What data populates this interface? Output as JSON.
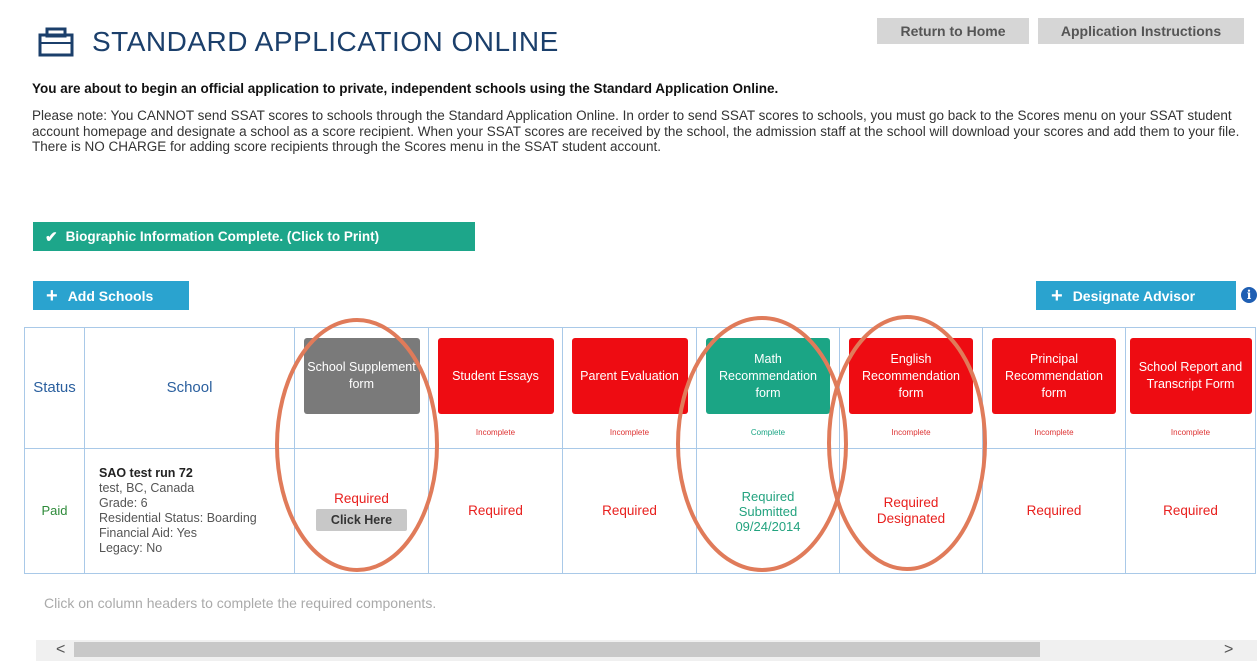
{
  "header": {
    "title": "STANDARD APPLICATION ONLINE",
    "return_home": "Return to Home",
    "instructions": "Application Instructions"
  },
  "intro": "You are about to begin an official application to private, independent schools using the Standard Application Online.",
  "note": "Please note: You CANNOT send SSAT scores to schools through the Standard Application Online. In order to send SSAT scores to schools, you must go back to the Scores menu on your SSAT student account homepage and designate a school as a score recipient. When your SSAT scores are received by the school, the admission staff at the school will download your scores and add them to your file. There is NO CHARGE for adding score recipients through the Scores menu in the SSAT student account.",
  "bio_button": "Biographic Information Complete. (Click to Print)",
  "add_schools": "Add Schools",
  "designate_advisor": "Designate Advisor",
  "table": {
    "status_header": "Status",
    "school_header": "School",
    "columns": [
      {
        "label": "School Supplement form",
        "status": "",
        "color": "grey"
      },
      {
        "label": "Student Essays",
        "status": "Incomplete",
        "color": "red"
      },
      {
        "label": "Parent Evaluation",
        "status": "Incomplete",
        "color": "red"
      },
      {
        "label": "Math Recommendation form",
        "status": "Complete",
        "color": "green"
      },
      {
        "label": "English Recommendation form",
        "status": "Incomplete",
        "color": "red"
      },
      {
        "label": "Principal Recommendation form",
        "status": "Incomplete",
        "color": "red"
      },
      {
        "label": "School Report and Transcript Form",
        "status": "Incomplete",
        "color": "red"
      }
    ],
    "row": {
      "status": "Paid",
      "school_name": "SAO test run 72",
      "location": "test, BC, Canada",
      "grade": "Grade: 6",
      "residential": "Residential Status: Boarding",
      "financial_aid": "Financial Aid: Yes",
      "legacy": "Legacy: No",
      "supplement_required": "Required",
      "click_here": "Click Here",
      "essays": "Required",
      "parent": "Required",
      "math_required": "Required",
      "math_submitted": "Submitted",
      "math_date": "09/24/2014",
      "english_required": "Required",
      "english_designated": "Designated",
      "principal": "Required",
      "school_report": "Required"
    }
  },
  "footer_note": "Click on column headers to complete the required components.",
  "scroll": {
    "left": "<",
    "right": ">"
  },
  "colors": {
    "red": "#ee0c12",
    "green": "#1ba585",
    "blue": "#2aa3cf",
    "grey": "#7a7a7a",
    "annotation": "#e07b5a"
  }
}
